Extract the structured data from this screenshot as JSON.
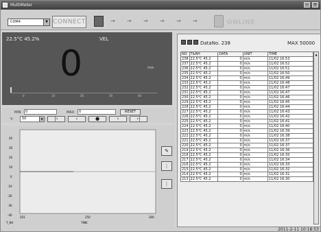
{
  "title": "MultiMeter",
  "toolbar": {
    "port": "COM4",
    "connect_label": "CONNECT",
    "online_label": "ONLINE"
  },
  "display": {
    "reading": "22.5°C 45.2%",
    "mode": "VEL",
    "value": "0",
    "unit": "m/s",
    "ticks": [
      "0",
      "10",
      "20",
      "30",
      "40"
    ]
  },
  "controls": {
    "min_label": "MIN",
    "min_value": "0",
    "max_label": "MAX",
    "max_value": "0",
    "reset_label": "RESET",
    "y_label": "Y:",
    "y_value": "50"
  },
  "chart": {
    "yticks": [
      "40",
      "30",
      "20",
      "10",
      "0",
      "-10",
      "-20",
      "-30",
      "-40"
    ],
    "xstart": "201",
    "xmid": "250",
    "xend": "300",
    "left_label": "T_RH",
    "time_label": "TIME"
  },
  "data_panel": {
    "data_no_label": "DataNo.",
    "data_no": "238",
    "max_label": "MAX",
    "max_value": "50000",
    "columns": [
      "NO",
      "T&RH",
      "DATA",
      "UNIT",
      "TIME"
    ],
    "rows": [
      [
        "238",
        "22.5°C 45.2",
        "0",
        "m/s",
        "11/02 16:53"
      ],
      [
        "237",
        "22.5°C 45.2",
        "0",
        "m/s",
        "11/02 16:52"
      ],
      [
        "236",
        "22.5°C 45.2",
        "0",
        "m/s",
        "11/02 16:51"
      ],
      [
        "235",
        "22.5°C 45.2",
        "0",
        "m/s",
        "11/02 16:50"
      ],
      [
        "234",
        "22.5°C 45.2",
        "0",
        "m/s",
        "11/02 16:49"
      ],
      [
        "233",
        "22.5°C 45.2",
        "0",
        "m/s",
        "11/02 16:48"
      ],
      [
        "232",
        "22.5°C 45.2",
        "0",
        "m/s",
        "11/02 16:47"
      ],
      [
        "231",
        "22.5°C 45.2",
        "0",
        "m/s",
        "11/02 16:47"
      ],
      [
        "230",
        "22.5°C 45.2",
        "0",
        "m/s",
        "11/02 16:46"
      ],
      [
        "229",
        "22.5°C 45.2",
        "0",
        "m/s",
        "11/02 16:45"
      ],
      [
        "228",
        "22.5°C 45.2",
        "0",
        "m/s",
        "11/02 16:44"
      ],
      [
        "227",
        "22.5°C 45.2",
        "0",
        "m/s",
        "11/02 16:43"
      ],
      [
        "226",
        "22.5°C 45.2",
        "0",
        "m/s",
        "11/02 16:42"
      ],
      [
        "225",
        "22.5°C 45.2",
        "0",
        "m/s",
        "11/02 16:41"
      ],
      [
        "224",
        "22.5°C 45.2",
        "0",
        "m/s",
        "11/02 16:40"
      ],
      [
        "223",
        "22.5°C 45.2",
        "0",
        "m/s",
        "11/02 16:39"
      ],
      [
        "222",
        "22.5°C 45.2",
        "0",
        "m/s",
        "11/02 16:38"
      ],
      [
        "221",
        "22.5°C 45.2",
        "0",
        "m/s",
        "11/02 16:37"
      ],
      [
        "220",
        "22.5°C 45.2",
        "0",
        "m/s",
        "11/02 16:37"
      ],
      [
        "219",
        "22.5°C 45.2",
        "0",
        "m/s",
        "11/02 16:36"
      ],
      [
        "218",
        "22.5°C 45.2",
        "0",
        "m/s",
        "11/02 16:35"
      ],
      [
        "217",
        "22.5°C 45.2",
        "0",
        "m/s",
        "11/02 16:34"
      ],
      [
        "216",
        "22.5°C 45.2",
        "0",
        "m/s",
        "11/02 16:33"
      ],
      [
        "215",
        "22.5°C 45.2",
        "0",
        "m/s",
        "11/02 16:32"
      ],
      [
        "214",
        "22.5°C 45.2",
        "0",
        "m/s",
        "11/02 16:31"
      ],
      [
        "213",
        "22.5°C 45.2",
        "0",
        "m/s",
        "11/02 16:30"
      ]
    ]
  },
  "status": {
    "datetime": "2011-2-11 10:18:53"
  }
}
